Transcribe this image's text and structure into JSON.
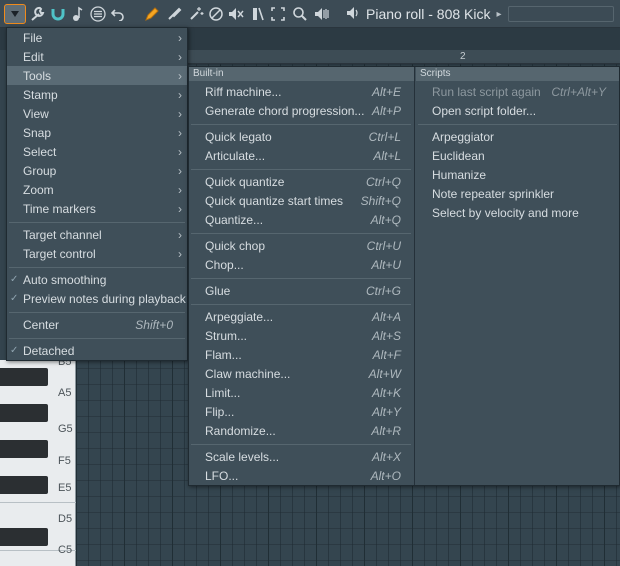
{
  "toolbar": {
    "title": "Piano roll - 808 Kick",
    "title_arrow": "▸"
  },
  "ruler": {
    "bar_label": "2"
  },
  "keyboard": {
    "labels": [
      "B5",
      "A5",
      "G5",
      "F5",
      "E5",
      "D5",
      "C5"
    ]
  },
  "main_menu": {
    "items": [
      {
        "label": "File",
        "submenu": true
      },
      {
        "label": "Edit",
        "submenu": true
      },
      {
        "label": "Tools",
        "submenu": true,
        "active": true
      },
      {
        "label": "Stamp",
        "submenu": true
      },
      {
        "label": "View",
        "submenu": true
      },
      {
        "label": "Snap",
        "submenu": true
      },
      {
        "label": "Select",
        "submenu": true
      },
      {
        "label": "Group",
        "submenu": true
      },
      {
        "label": "Zoom",
        "submenu": true
      },
      {
        "label": "Time markers",
        "submenu": true
      },
      {
        "label": "Target channel",
        "submenu": true
      },
      {
        "label": "Target control",
        "submenu": true
      },
      {
        "label": "Auto smoothing",
        "checked": true
      },
      {
        "label": "Preview notes during playback",
        "checked": true
      },
      {
        "label": "Center",
        "shortcut": "Shift+0"
      },
      {
        "label": "Detached",
        "checked": true
      }
    ]
  },
  "tools_menu": {
    "builtin_header": "Built-in",
    "scripts_header": "Scripts",
    "builtin_items": [
      {
        "label": "Riff machine...",
        "shortcut": "Alt+E"
      },
      {
        "label": "Generate chord progression...",
        "shortcut": "Alt+P"
      },
      {
        "label": "Quick legato",
        "shortcut": "Ctrl+L"
      },
      {
        "label": "Articulate...",
        "shortcut": "Alt+L"
      },
      {
        "label": "Quick quantize",
        "shortcut": "Ctrl+Q"
      },
      {
        "label": "Quick quantize start times",
        "shortcut": "Shift+Q"
      },
      {
        "label": "Quantize...",
        "shortcut": "Alt+Q"
      },
      {
        "label": "Quick chop",
        "shortcut": "Ctrl+U"
      },
      {
        "label": "Chop...",
        "shortcut": "Alt+U"
      },
      {
        "label": "Glue",
        "shortcut": "Ctrl+G"
      },
      {
        "label": "Arpeggiate...",
        "shortcut": "Alt+A"
      },
      {
        "label": "Strum...",
        "shortcut": "Alt+S"
      },
      {
        "label": "Flam...",
        "shortcut": "Alt+F"
      },
      {
        "label": "Claw machine...",
        "shortcut": "Alt+W"
      },
      {
        "label": "Limit...",
        "shortcut": "Alt+K"
      },
      {
        "label": "Flip...",
        "shortcut": "Alt+Y"
      },
      {
        "label": "Randomize...",
        "shortcut": "Alt+R"
      },
      {
        "label": "Scale levels...",
        "shortcut": "Alt+X"
      },
      {
        "label": "LFO...",
        "shortcut": "Alt+O"
      }
    ],
    "script_items": [
      {
        "label": "Run last script again",
        "shortcut": "Ctrl+Alt+Y",
        "disabled": true
      },
      {
        "label": "Open script folder..."
      },
      {
        "label": "Arpeggiator"
      },
      {
        "label": "Euclidean"
      },
      {
        "label": "Humanize"
      },
      {
        "label": "Note repeater sprinkler"
      },
      {
        "label": "Select by velocity and more"
      }
    ]
  },
  "icons": {
    "checkmark": "✓",
    "chevron": "›"
  },
  "colors": {
    "accent": "#f08b1c",
    "menu_bg": "#3f4f59",
    "menu_highlight": "#5a6b75"
  }
}
